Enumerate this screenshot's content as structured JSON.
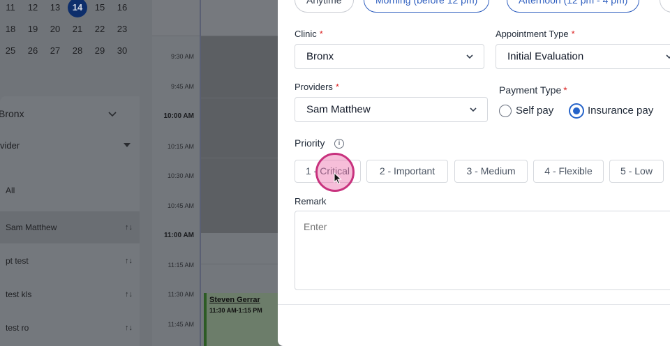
{
  "calendar": {
    "rows": [
      [
        "11",
        "12",
        "13",
        "14",
        "15",
        "16"
      ],
      [
        "18",
        "19",
        "20",
        "21",
        "22",
        "23"
      ],
      [
        "25",
        "26",
        "27",
        "28",
        "29",
        "30"
      ]
    ],
    "selected_day": "14"
  },
  "sidebar": {
    "clinic_value": "Bronx",
    "provider_select": "vider",
    "providers": [
      {
        "name": "All"
      },
      {
        "name": "Sam Matthew",
        "active": true
      },
      {
        "name": "pt test"
      },
      {
        "name": "test kls"
      },
      {
        "name": "test ro"
      }
    ],
    "sort_glyph": "↑↓"
  },
  "timeline": {
    "times": [
      "9:30 AM",
      "9:45 AM",
      "10:00 AM",
      "10:15 AM",
      "10:30 AM",
      "10:45 AM",
      "11:00 AM",
      "11:15 AM",
      "11:30 AM",
      "11:45 AM"
    ],
    "appointment": {
      "name": "Steven Gerrar",
      "time": "11:30 AM-1:15 PM"
    }
  },
  "modal": {
    "time_chips": [
      "Anytime",
      "Morning (before 12 pm)",
      "Afternoon (12 pm - 4 pm)"
    ],
    "clinic": {
      "label": "Clinic",
      "value": "Bronx"
    },
    "appointment_type": {
      "label": "Appointment Type",
      "value": "Initial Evaluation"
    },
    "providers": {
      "label": "Providers",
      "value": "Sam Matthew"
    },
    "payment_type": {
      "label": "Payment Type",
      "options": [
        "Self pay",
        "Insurance pay"
      ],
      "selected": "Insurance pay"
    },
    "priority": {
      "label": "Priority",
      "info_glyph": "i",
      "options": [
        "1 - Critical",
        "2 - Important",
        "3 - Medium",
        "4 - Flexible",
        "5 - Low"
      ]
    },
    "remark": {
      "label": "Remark",
      "placeholder": "Enter"
    },
    "required_mark": "*"
  },
  "colors": {
    "accent": "#2563c9",
    "required": "#dc2626",
    "click_highlight": "#c8327e"
  }
}
